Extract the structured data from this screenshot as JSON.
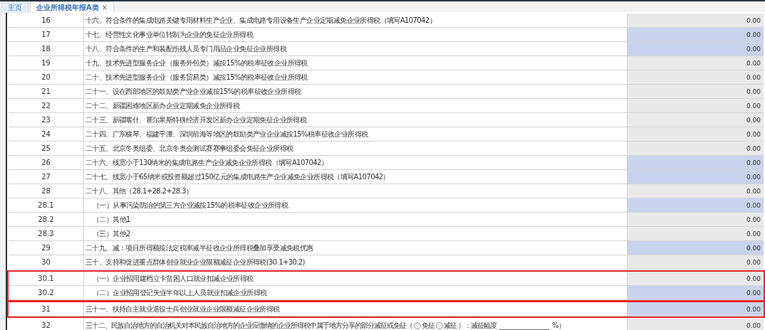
{
  "tabs": [
    {
      "label": "主页",
      "selected": false,
      "closable": false
    },
    {
      "label": "企业所得税年报A类",
      "selected": true,
      "closable": true
    }
  ],
  "close_glyph": "×",
  "row_groups": [
    {
      "outlined": false,
      "rows": [
        {
          "kind": "item",
          "number": "16",
          "text": "十六、符合条件的集成电路关键专用材料生产企业、集成电路专用设备生产企业定期减免企业所得税（填写A107042）",
          "amount": "0.00",
          "editable": false
        },
        {
          "kind": "item",
          "number": "17",
          "text": "十七、经营性文化事业单位转制为企业的免征企业所得税",
          "amount": "0.00",
          "editable": true
        },
        {
          "kind": "item",
          "number": "18",
          "text": "十八、符合条件的生产和装配伤残人员专门用品企业免征企业所得税",
          "amount": "0.00",
          "editable": true
        },
        {
          "kind": "item",
          "number": "19",
          "text": "十九、技术先进型服务企业（服务外包类）减按15%的税率征收企业所得税",
          "amount": "0.00",
          "editable": false
        },
        {
          "kind": "item",
          "number": "20",
          "text": "二十、技术先进型服务企业（服务贸易类）减按15%的税率征收企业所得税",
          "amount": "0.00",
          "editable": false
        },
        {
          "kind": "item",
          "number": "21",
          "text": "二十一、设在西部地区的鼓励类产业企业减按15%的税率征收企业所得税",
          "amount": "0.00",
          "editable": false
        },
        {
          "kind": "item",
          "number": "22",
          "text": "二十二、新疆困难地区新办企业定期减免企业所得税",
          "amount": "0.00",
          "editable": false
        },
        {
          "kind": "item",
          "number": "23",
          "text": "二十三、新疆喀什、霍尔果斯特殊经济开发区新办企业定期免征企业所得税",
          "amount": "0.00",
          "editable": false
        },
        {
          "kind": "item",
          "number": "24",
          "text": "二十四、广东横琴、福建平潭、深圳前海等地区的鼓励类产业企业减按15%税率征收企业所得税",
          "amount": "0.00",
          "editable": false
        },
        {
          "kind": "item",
          "number": "25",
          "text": "二十五、北京冬奥组委、北京冬奥会测试赛赛事组委会免征企业所得税",
          "amount": "0.00",
          "editable": false
        },
        {
          "kind": "item",
          "number": "26",
          "text": "二十六、线宽小于130纳米的集成电路生产企业减免企业所得税（填写A107042）",
          "amount": "0.00",
          "editable": true
        },
        {
          "kind": "item",
          "number": "27",
          "text": "二十七、线宽小于65纳米或投资额超过150亿元的集成电路生产企业减免企业所得税（填写A107042）",
          "amount": "0.00",
          "editable": true
        },
        {
          "kind": "item",
          "number": "28",
          "text": "二十八、其他（28.1+28.2+28.3）",
          "amount": "0.00",
          "editable": false
        },
        {
          "kind": "subitem",
          "number": "28.1",
          "text": "（一）从事污染防治的第三方企业减按15%的税率征收企业所得税",
          "amount": "0.00",
          "editable": true
        },
        {
          "kind": "subitem",
          "number": "28.2",
          "text": "（二）其他1",
          "amount": "0.00",
          "editable": false
        },
        {
          "kind": "subitem",
          "number": "28.3",
          "text": "（三）其他2",
          "amount": "0.00",
          "editable": false
        },
        {
          "kind": "item",
          "number": "29",
          "text": "二十九、减：项目所得额按法定税率减半征收企业所得税叠加享受减免税优惠",
          "amount": "0.00",
          "editable": true
        },
        {
          "kind": "item",
          "number": "30",
          "text": "三十、支持和促进重点群体创业就业企业限额减征企业所得税(30.1+30.2)",
          "amount": "0.00",
          "editable": false
        }
      ]
    },
    {
      "outlined": true,
      "rows": [
        {
          "kind": "subitem",
          "number": "30.1",
          "text": "（一）企业招用建档立卡贫困人口就业扣减企业所得税",
          "amount": "0.00",
          "editable": false
        },
        {
          "kind": "subitem",
          "number": "30.2",
          "text": "（二）企业招用登记失业半年以上人员就业扣减企业所得税",
          "amount": "0.00",
          "editable": true
        }
      ]
    },
    {
      "outlined": true,
      "rows": [
        {
          "kind": "item",
          "number": "31",
          "text": "三十一、扶持自主就业退役士兵创业就业企业限额减征企业所得税",
          "amount": "0.00",
          "editable": true
        }
      ]
    },
    {
      "outlined": false,
      "rows": [
        {
          "kind": "choice",
          "number": "32",
          "text": "三十二、民族自治地方的自治机关对本民族自治地方的企业应缴纳的企业所得税中属于地方分享的部分减征或免征（",
          "options": [
            {
              "label": "免征",
              "selected": false
            },
            {
              "label": "减征",
              "selected": false
            }
          ],
          "after_options": "）：减征幅度",
          "unit": "%）",
          "amount": "0.00",
          "editable": false
        }
      ]
    }
  ]
}
